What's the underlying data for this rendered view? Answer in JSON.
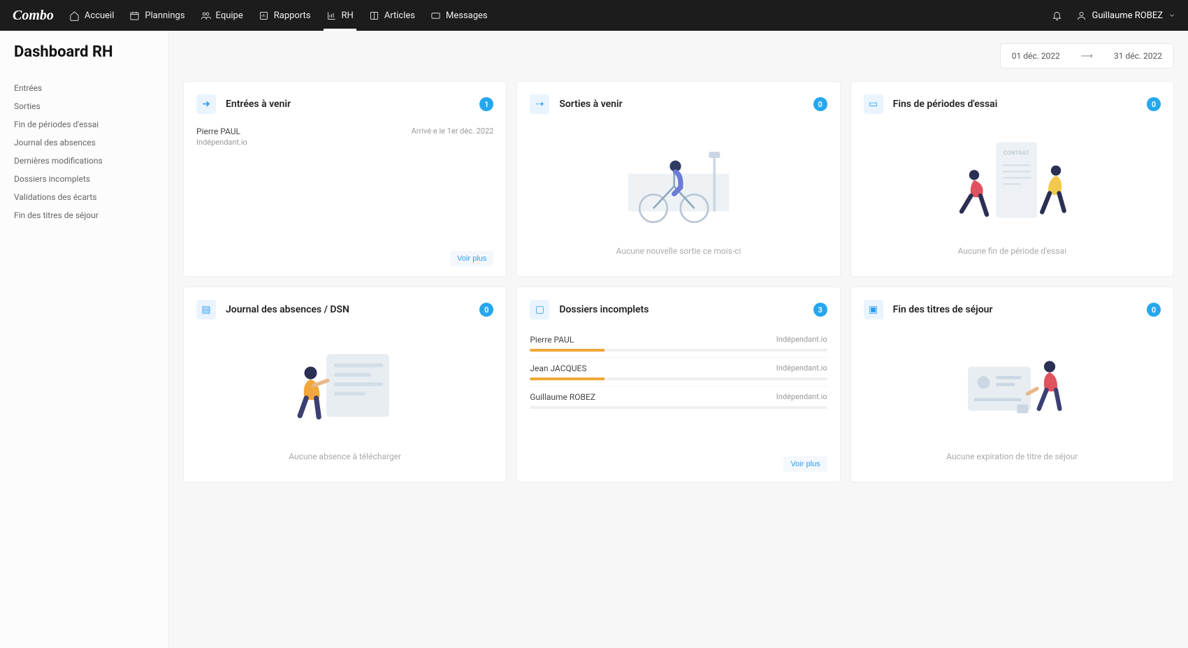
{
  "brand": "Combo",
  "nav": {
    "home": "Accueil",
    "plannings": "Plannings",
    "team": "Equipe",
    "reports": "Rapports",
    "rh": "RH",
    "articles": "Articles",
    "messages": "Messages"
  },
  "user": {
    "name": "Guillaume ROBEZ"
  },
  "page_title": "Dashboard RH",
  "sidebar_items": [
    "Entrées",
    "Sorties",
    "Fin de périodes d'essai",
    "Journal des absences",
    "Dernières modifications",
    "Dossiers incomplets",
    "Validations des écarts",
    "Fin des titres de séjour"
  ],
  "date_range": {
    "from": "01 déc. 2022",
    "to": "31 déc. 2022"
  },
  "cards": {
    "entrees": {
      "title": "Entrées à venir",
      "count": "1",
      "items": [
        {
          "name": "Pierre PAUL",
          "loc": "Indépendant.io",
          "detail": "Arrivé·e le 1er déc. 2022"
        }
      ],
      "more": "Voir plus"
    },
    "sorties": {
      "title": "Sorties à venir",
      "count": "0",
      "empty": "Aucune nouvelle sortie ce mois-ci"
    },
    "essai": {
      "title": "Fins de périodes d'essai",
      "count": "0",
      "empty": "Aucune fin de période d'essai"
    },
    "absences": {
      "title": "Journal des absences / DSN",
      "count": "0",
      "empty": "Aucune absence à télécharger"
    },
    "dossiers": {
      "title": "Dossiers incomplets",
      "count": "3",
      "items": [
        {
          "name": "Pierre PAUL",
          "loc": "Indépendant.io",
          "progress": 25
        },
        {
          "name": "Jean JACQUES",
          "loc": "Indépendant.io",
          "progress": 25
        },
        {
          "name": "Guillaume ROBEZ",
          "loc": "Indépendant.io",
          "progress": 0
        }
      ],
      "more": "Voir plus"
    },
    "sejour": {
      "title": "Fin des titres de séjour",
      "count": "0",
      "empty": "Aucune expiration de titre de séjour"
    }
  }
}
